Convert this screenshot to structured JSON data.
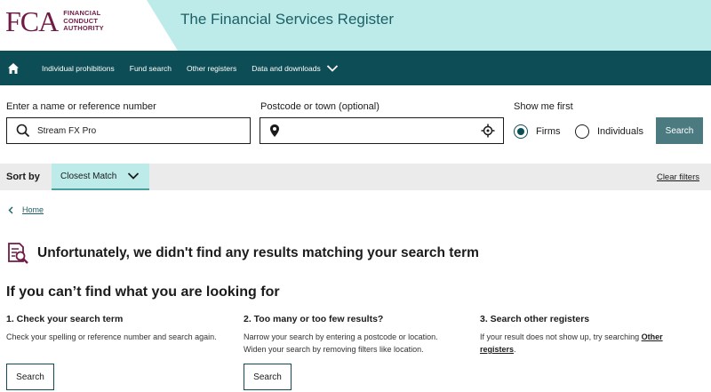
{
  "header": {
    "logo_mark": "FCA",
    "logo_line1": "FINANCIAL",
    "logo_line2": "CONDUCT",
    "logo_line3": "AUTHORITY",
    "title": "The Financial Services Register"
  },
  "nav": {
    "items": [
      {
        "label": "Individual prohibitions"
      },
      {
        "label": "Fund search"
      },
      {
        "label": "Other registers"
      },
      {
        "label": "Data and downloads"
      }
    ]
  },
  "search": {
    "name_label": "Enter a name or reference number",
    "name_value": "Stream FX Pro",
    "postcode_label": "Postcode or town (optional)",
    "postcode_value": "",
    "show_first_label": "Show me first",
    "option_firms": "Firms",
    "option_individuals": "Individuals",
    "selected": "Firms",
    "search_button": "Search"
  },
  "sort": {
    "label": "Sort by",
    "value": "Closest Match",
    "clear_filters": "Clear filters"
  },
  "breadcrumb": {
    "home": "Home"
  },
  "results": {
    "no_results": "Unfortunately, we didn't find any results matching your search term",
    "help_title": "If you can’t find what you are looking for",
    "col1_title": "1. Check your search term",
    "col1_text": "Check your spelling or reference number and search again.",
    "col1_button": "Search",
    "col2_title": "2. Too many or too few results?",
    "col2_text": "Narrow your search by entering a postcode or location. Widen your search by removing filters like location.",
    "col2_button": "Search",
    "col3_title": "3. Search other registers",
    "col3_text_before": "If your result does not show up, try searching ",
    "col3_link": "Other registers",
    "col3_text_after": "."
  },
  "colors": {
    "brand": "#701b45",
    "nav_bg": "#0d4d55",
    "band": "#bcebe9",
    "button": "#4b7b80"
  }
}
